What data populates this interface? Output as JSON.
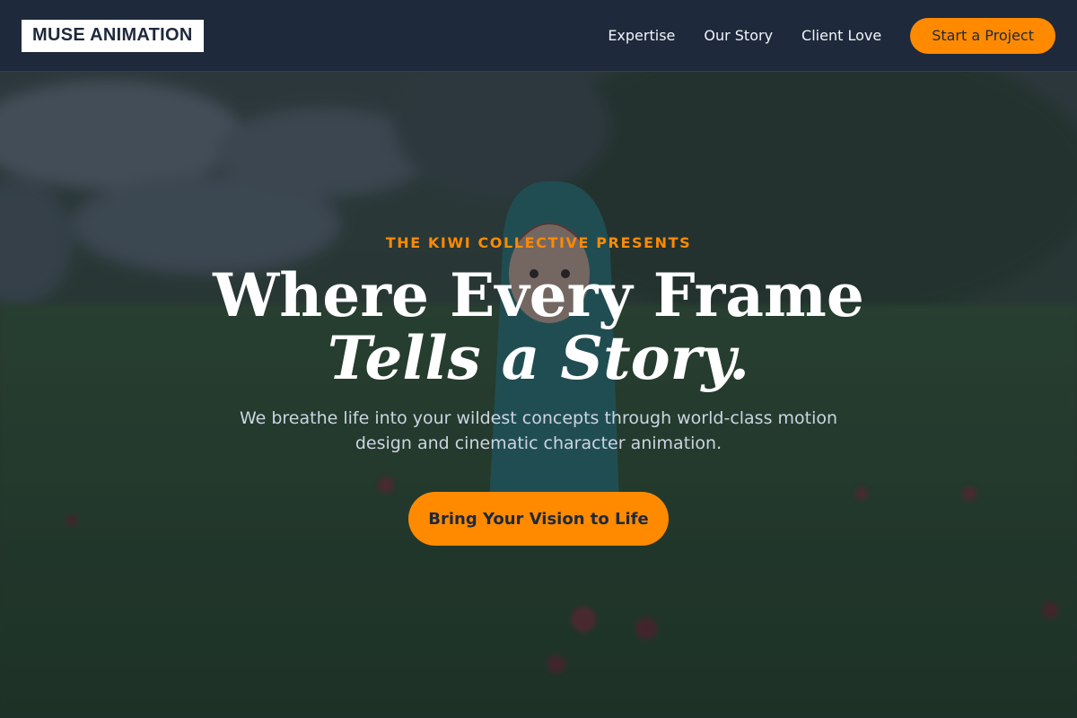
{
  "brand": {
    "logo_text": "MUSE ANIMATION"
  },
  "nav": {
    "links": [
      {
        "label": "Expertise"
      },
      {
        "label": "Our Story"
      },
      {
        "label": "Client Love"
      }
    ],
    "cta_label": "Start a Project"
  },
  "hero": {
    "eyebrow": "THE KIWI COLLECTIVE PRESENTS",
    "headline_line1": "Where Every Frame",
    "headline_line2": "Tells a Story.",
    "subtext": "We breathe life into your wildest concepts through world-class motion design and cinematic character animation.",
    "cta_label": "Bring Your Vision to Life",
    "background_description_icon": "figurine-in-grass-photo"
  },
  "colors": {
    "nav_bg": "#1e293b",
    "accent": "#ff8a00",
    "text_light": "#ffffff",
    "subtext": "#cbd5e1"
  }
}
